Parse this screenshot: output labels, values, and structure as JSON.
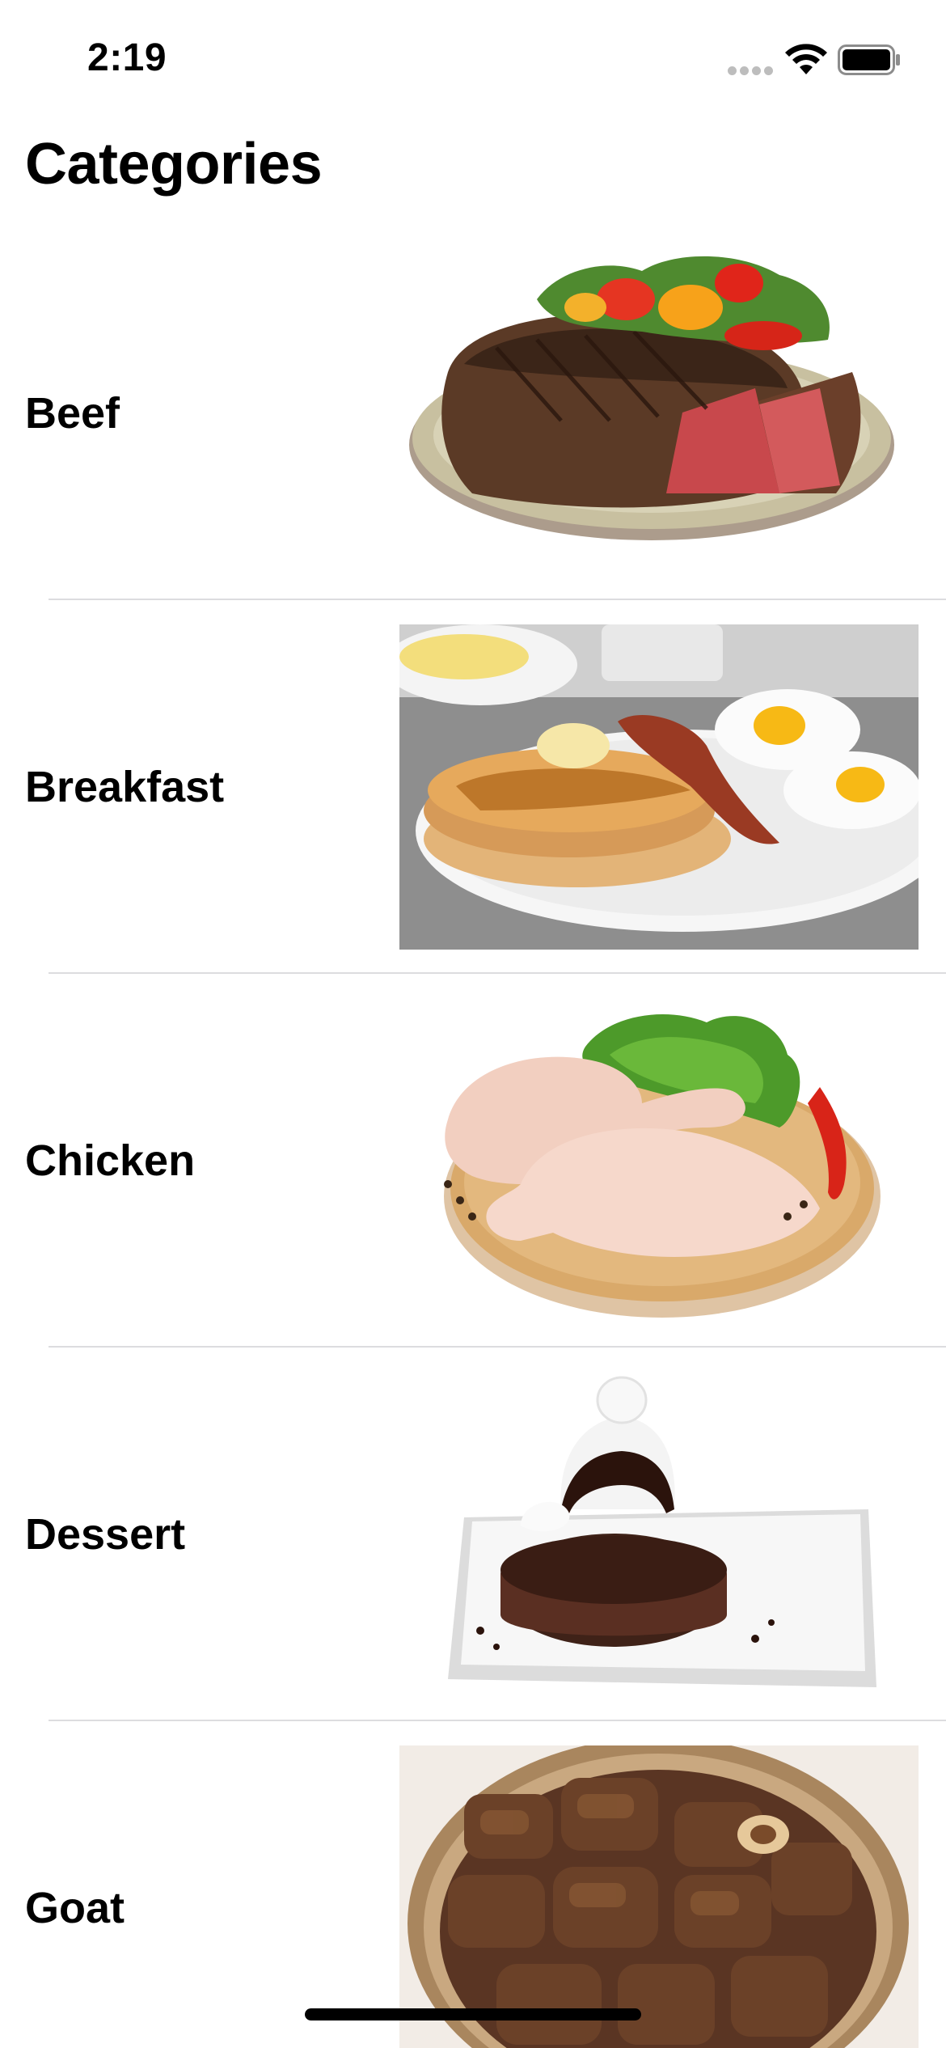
{
  "status_bar": {
    "time": "2:19",
    "icons": [
      "signal-dots-icon",
      "wifi-icon",
      "battery-icon"
    ]
  },
  "header": {
    "title": "Categories"
  },
  "categories": [
    {
      "label": "Beef",
      "image": "steak-plate-image"
    },
    {
      "label": "Breakfast",
      "image": "pancakes-eggs-bacon-image"
    },
    {
      "label": "Chicken",
      "image": "raw-chicken-board-image"
    },
    {
      "label": "Dessert",
      "image": "chocolate-brownie-dessert-image"
    },
    {
      "label": "Goat",
      "image": "goat-stew-bowl-image"
    }
  ],
  "colors": {
    "text": "#000000",
    "divider": "#dcdcdf",
    "background": "#ffffff"
  }
}
